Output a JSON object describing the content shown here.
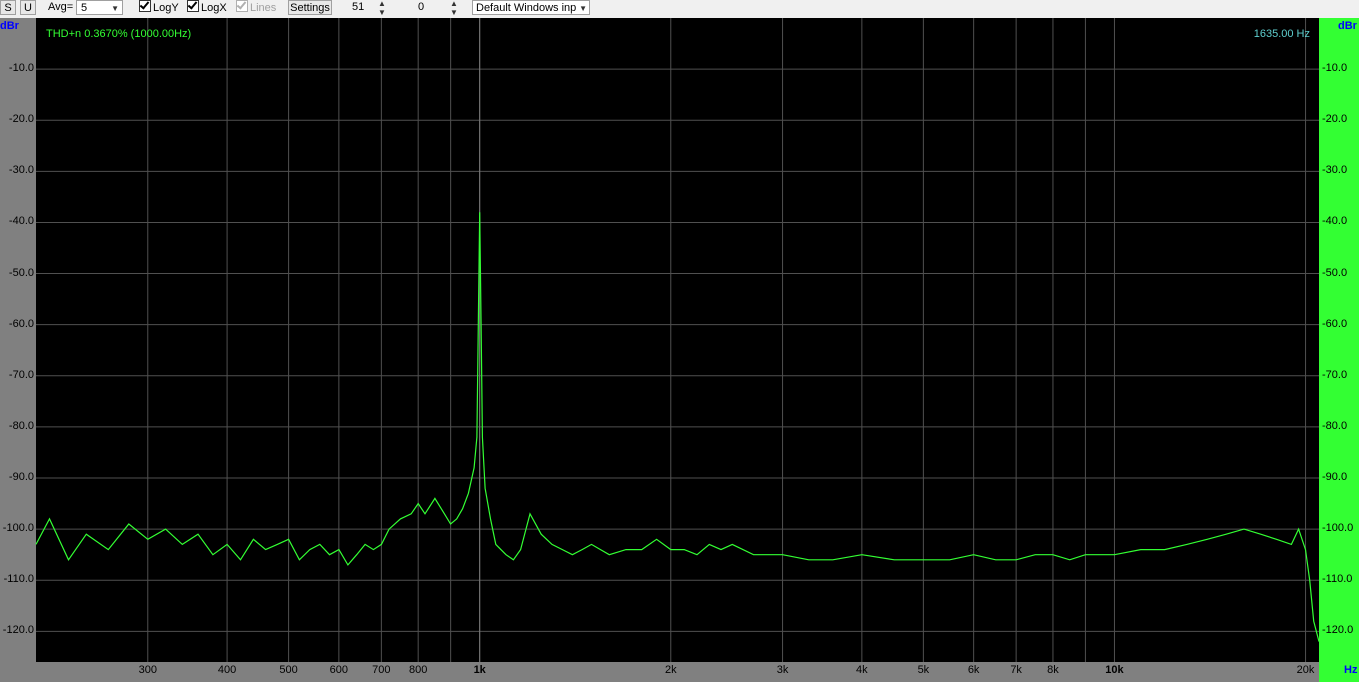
{
  "toolbar": {
    "s_label": "S",
    "u_label": "U",
    "avg_label": "Avg=",
    "avg_value": "5",
    "logy_label": "LogY",
    "logy_checked": true,
    "logx_label": "LogX",
    "logx_checked": true,
    "lines_label": "Lines",
    "lines_checked": true,
    "lines_enabled": false,
    "settings_label": "Settings",
    "spin1_value": "51",
    "spin2_value": "0",
    "device_value": "Default Windows inp"
  },
  "readouts": {
    "thd": "THD+n 0.3670% (1000.00Hz)",
    "frequency": "1635.00 Hz"
  },
  "colors": {
    "trace": "#33ff33",
    "plot_bg": "#000000",
    "grid": "#505050",
    "axis_bg": "#808080",
    "right_axis_bg": "#33ff33",
    "unit_text": "#0000ff"
  },
  "chart_data": {
    "type": "line",
    "x_scale": "log",
    "y_unit_label": "dBr",
    "x_unit_label": "Hz",
    "xlim": [
      200,
      21000
    ],
    "ylim": [
      -126,
      0
    ],
    "y_ticks": [
      "-10.0",
      "-20.0",
      "-30.0",
      "-40.0",
      "-50.0",
      "-60.0",
      "-70.0",
      "-80.0",
      "-90.0",
      "-100.0",
      "-110.0",
      "-120.0"
    ],
    "y_tick_values": [
      -10,
      -20,
      -30,
      -40,
      -50,
      -60,
      -70,
      -80,
      -90,
      -100,
      -110,
      -120
    ],
    "x_ticks": [
      {
        "label": "300",
        "value": 300,
        "major": false
      },
      {
        "label": "400",
        "value": 400,
        "major": false
      },
      {
        "label": "500",
        "value": 500,
        "major": false
      },
      {
        "label": "600",
        "value": 600,
        "major": false
      },
      {
        "label": "700",
        "value": 700,
        "major": false
      },
      {
        "label": "800",
        "value": 800,
        "major": false
      },
      {
        "label": "1k",
        "value": 1000,
        "major": true
      },
      {
        "label": "2k",
        "value": 2000,
        "major": false
      },
      {
        "label": "3k",
        "value": 3000,
        "major": false
      },
      {
        "label": "4k",
        "value": 4000,
        "major": false
      },
      {
        "label": "5k",
        "value": 5000,
        "major": false
      },
      {
        "label": "6k",
        "value": 6000,
        "major": false
      },
      {
        "label": "7k",
        "value": 7000,
        "major": false
      },
      {
        "label": "8k",
        "value": 8000,
        "major": false
      },
      {
        "label": "10k",
        "value": 10000,
        "major": true
      },
      {
        "label": "20k",
        "value": 20000,
        "major": false
      }
    ],
    "x_grid": [
      300,
      400,
      500,
      600,
      700,
      800,
      900,
      1000,
      2000,
      3000,
      4000,
      5000,
      6000,
      7000,
      8000,
      9000,
      10000,
      20000
    ],
    "cursor_hz": 1000,
    "series": [
      {
        "x": [
          200,
          210,
          225,
          240,
          260,
          280,
          300,
          320,
          340,
          360,
          380,
          400,
          420,
          440,
          460,
          480,
          500,
          520,
          540,
          560,
          580,
          600,
          620,
          640,
          660,
          680,
          700,
          720,
          750,
          780,
          800,
          820,
          850,
          880,
          900,
          920,
          940,
          960,
          980,
          990,
          995,
          1000,
          1005,
          1010,
          1020,
          1040,
          1060,
          1080,
          1100,
          1130,
          1160,
          1200,
          1250,
          1300,
          1350,
          1400,
          1450,
          1500,
          1550,
          1600,
          1700,
          1800,
          1900,
          2000,
          2100,
          2200,
          2300,
          2400,
          2500,
          2700,
          3000,
          3300,
          3600,
          4000,
          4500,
          5000,
          5500,
          6000,
          6500,
          7000,
          7500,
          8000,
          8500,
          9000,
          10000,
          11000,
          12000,
          13000,
          14000,
          15000,
          16000,
          17000,
          18000,
          19000,
          19500,
          20000,
          20300,
          20600,
          21000
        ],
        "y": [
          -103,
          -98,
          -106,
          -101,
          -104,
          -99,
          -102,
          -100,
          -103,
          -101,
          -105,
          -103,
          -106,
          -102,
          -104,
          -103,
          -102,
          -106,
          -104,
          -103,
          -105,
          -104,
          -107,
          -105,
          -103,
          -104,
          -103,
          -100,
          -98,
          -97,
          -95,
          -97,
          -94,
          -97,
          -99,
          -98,
          -96,
          -93,
          -88,
          -82,
          -60,
          -38,
          -60,
          -82,
          -92,
          -98,
          -103,
          -104,
          -105,
          -106,
          -104,
          -97,
          -101,
          -103,
          -104,
          -105,
          -104,
          -103,
          -104,
          -105,
          -104,
          -104,
          -102,
          -104,
          -104,
          -105,
          -103,
          -104,
          -103,
          -105,
          -105,
          -106,
          -106,
          -105,
          -106,
          -106,
          -106,
          -105,
          -106,
          -106,
          -105,
          -105,
          -106,
          -105,
          -105,
          -104,
          -104,
          -103,
          -102,
          -101,
          -100,
          -101,
          -102,
          -103,
          -100,
          -104,
          -110,
          -118,
          -122
        ]
      }
    ]
  }
}
